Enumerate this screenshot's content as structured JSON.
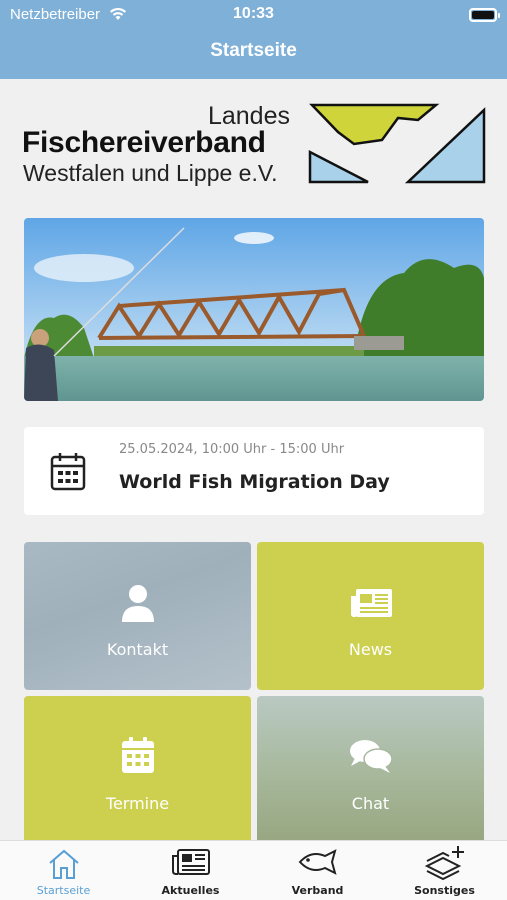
{
  "status_bar": {
    "carrier": "Netzbetreiber",
    "time": "10:33"
  },
  "nav": {
    "title": "Startseite"
  },
  "logo": {
    "line1": "Landes",
    "line2": "Fischereiverband",
    "line3": "Westfalen und Lippe e.V."
  },
  "event": {
    "date": "25.05.2024, 10:00 Uhr - 15:00 Uhr",
    "title": "World Fish Migration Day"
  },
  "tiles": [
    {
      "label": "Kontakt",
      "icon": "person-icon"
    },
    {
      "label": "News",
      "icon": "newspaper-icon"
    },
    {
      "label": "Termine",
      "icon": "calendar-icon"
    },
    {
      "label": "Chat",
      "icon": "chat-bubbles-icon"
    }
  ],
  "tabbar": {
    "items": [
      {
        "label": "Startseite",
        "icon": "home-icon",
        "active": true
      },
      {
        "label": "Aktuelles",
        "icon": "newspaper-icon",
        "active": false
      },
      {
        "label": "Verband",
        "icon": "fish-icon",
        "active": false
      },
      {
        "label": "Sonstiges",
        "icon": "layers-plus-icon",
        "active": false
      }
    ]
  },
  "colors": {
    "header": "#7fb0d8",
    "accent_tile": "#cdcf4f",
    "tab_active": "#5a9fd4"
  }
}
